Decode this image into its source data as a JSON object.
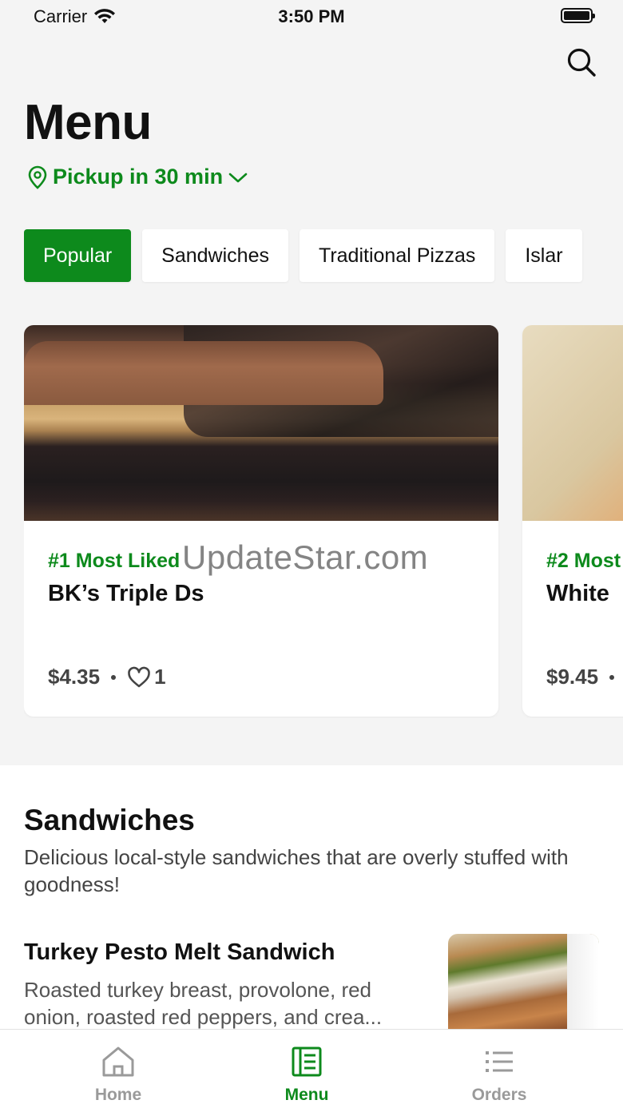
{
  "status_bar": {
    "carrier": "Carrier",
    "time": "3:50 PM"
  },
  "header": {
    "title": "Menu",
    "pickup_label": "Pickup in 30 min"
  },
  "tabs": [
    {
      "label": "Popular",
      "active": true
    },
    {
      "label": "Sandwiches",
      "active": false
    },
    {
      "label": "Traditional Pizzas",
      "active": false
    },
    {
      "label": "Islar",
      "active": false
    }
  ],
  "featured": [
    {
      "rank": "#1 Most Liked",
      "name": "BK’s Triple Ds",
      "price": "$4.35",
      "likes": "1"
    },
    {
      "rank": "#2 Most",
      "name": "White",
      "price": "$9.45"
    }
  ],
  "watermark": "UpdateStar.com",
  "section": {
    "title": "Sandwiches",
    "description": "Delicious local-style sandwiches that are overly stuffed with goodness!",
    "items": [
      {
        "name": "Turkey Pesto Melt Sandwich",
        "description": "Roasted turkey breast, provolone, red onion, roasted red peppers, and crea..."
      }
    ]
  },
  "bottom_nav": [
    {
      "label": "Home",
      "icon": "home-icon",
      "active": false
    },
    {
      "label": "Menu",
      "icon": "menu-book-icon",
      "active": true
    },
    {
      "label": "Orders",
      "icon": "list-icon",
      "active": false
    }
  ],
  "colors": {
    "accent": "#0d8a1c",
    "background": "#f4f4f4",
    "inactive": "#9a9a9a"
  }
}
